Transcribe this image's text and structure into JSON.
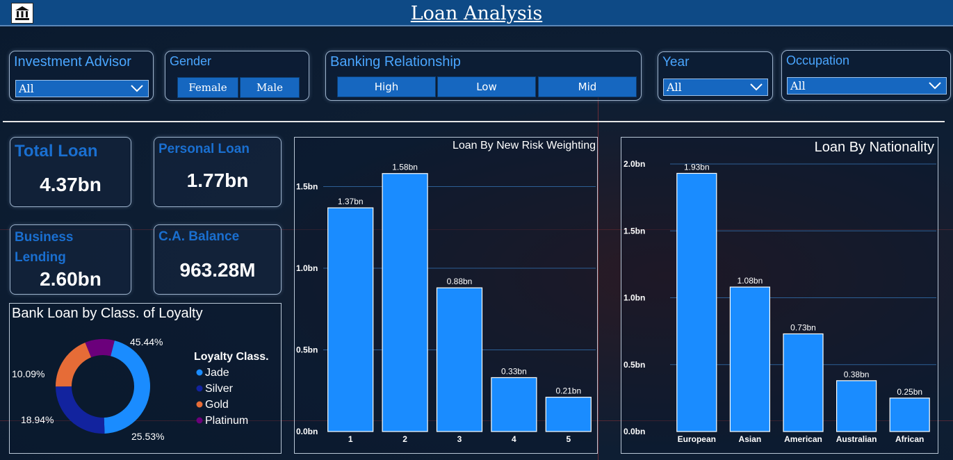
{
  "header": {
    "title": "Loan Analysis",
    "logo_icon": "bank-icon"
  },
  "filters": {
    "investment_advisor": {
      "label": "Investment Advisor",
      "value": "All"
    },
    "gender": {
      "label": "Gender",
      "options": [
        "Female",
        "Male"
      ]
    },
    "banking_relationship": {
      "label": "Banking Relationship",
      "options": [
        "High",
        "Low",
        "Mid"
      ]
    },
    "year": {
      "label": "Year",
      "value": "All"
    },
    "occupation": {
      "label": "Occupation",
      "value": "All"
    }
  },
  "kpis": {
    "total_loan": {
      "label": "Total Loan",
      "value": "4.37bn"
    },
    "personal_loan": {
      "label": "Personal Loan",
      "value": "1.77bn"
    },
    "business_lending": {
      "label": "Business Lending",
      "value": "2.60bn"
    },
    "ca_balance": {
      "label": "C.A. Balance",
      "value": "963.28M"
    }
  },
  "chart_data": [
    {
      "id": "loyalty",
      "type": "pie",
      "title": "Bank Loan by Class. of Loyalty",
      "legend_title": "Loyalty Class.",
      "legend_position": "right",
      "labels": [
        "Jade",
        "Silver",
        "Gold",
        "Platinum"
      ],
      "values": [
        45.44,
        25.53,
        18.94,
        10.09
      ],
      "value_labels": [
        "45.44%",
        "25.53%",
        "18.94%",
        "10.09%"
      ],
      "colors": [
        "#1a8cff",
        "#12239e",
        "#e66c37",
        "#6b007b"
      ]
    },
    {
      "id": "risk",
      "type": "bar",
      "title": "Loan By New Risk Weighting",
      "categories": [
        "1",
        "2",
        "3",
        "4",
        "5"
      ],
      "values": [
        1.37,
        1.58,
        0.88,
        0.33,
        0.21
      ],
      "data_labels": [
        "1.37bn",
        "1.58bn",
        "0.88bn",
        "0.33bn",
        "0.21bn"
      ],
      "y_ticks": [
        0,
        0.5,
        1.0,
        1.5
      ],
      "y_tick_labels": [
        "0.0bn",
        "0.5bn",
        "1.0bn",
        "1.5bn"
      ],
      "ylim": [
        0,
        1.63
      ],
      "grid": true,
      "bar_color": "#1a8cff"
    },
    {
      "id": "nationality",
      "type": "bar",
      "title": "Loan By Nationality",
      "categories": [
        "European",
        "Asian",
        "American",
        "Australian",
        "African"
      ],
      "values": [
        1.93,
        1.08,
        0.73,
        0.38,
        0.25
      ],
      "data_labels": [
        "1.93bn",
        "1.08bn",
        "0.73bn",
        "0.38bn",
        "0.25bn"
      ],
      "y_ticks": [
        0,
        0.5,
        1.0,
        1.5,
        2.0
      ],
      "y_tick_labels": [
        "0.0bn",
        "0.5bn",
        "1.0bn",
        "1.5bn",
        "2.0bn"
      ],
      "ylim": [
        0,
        2.0
      ],
      "grid": true,
      "bar_color": "#1a8cff"
    }
  ]
}
